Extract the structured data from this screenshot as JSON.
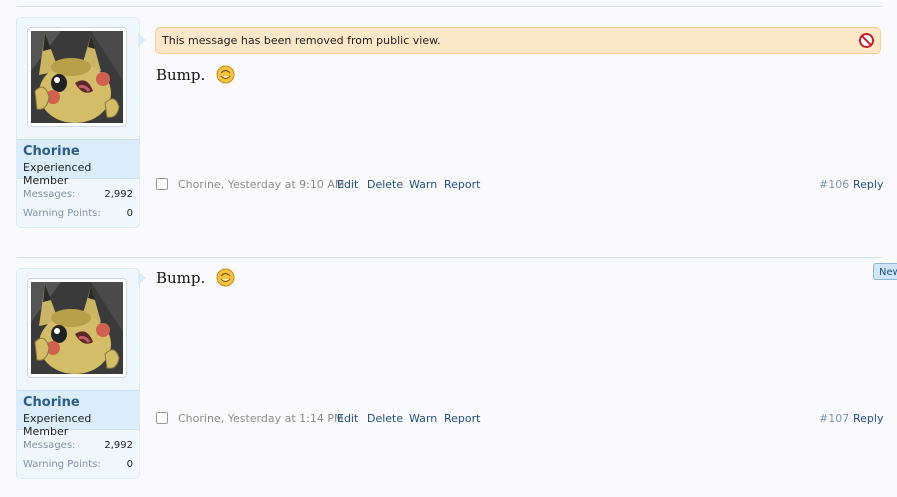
{
  "posts": [
    {
      "username": "Chorine",
      "user_title": "Experienced Member",
      "stats": [
        {
          "label": "Messages:",
          "value": "2,992"
        },
        {
          "label": "Warning Points:",
          "value": "0"
        }
      ],
      "notice": "This message has been removed from public view.",
      "message": "Bump.",
      "meta": "Chorine, Yesterday at 9:10 AM",
      "actions": [
        "Edit",
        "Delete",
        "Warn",
        "Report"
      ],
      "post_number": "#106",
      "reply_label": "Reply"
    },
    {
      "username": "Chorine",
      "user_title": "Experienced Member",
      "stats": [
        {
          "label": "Messages:",
          "value": "2,992"
        },
        {
          "label": "Warning Points:",
          "value": "0"
        }
      ],
      "message": "Bump.",
      "meta": "Chorine, Yesterday at 1:14 PM",
      "actions": [
        "Edit",
        "Delete",
        "Warn",
        "Report"
      ],
      "post_number": "#107",
      "reply_label": "Reply"
    }
  ],
  "new_badge": "New",
  "icons": {
    "notice": "no-entry-icon",
    "emoji": "smiley-face-icon",
    "avatar": "pikachu-avatar"
  },
  "colors": {
    "username": "#2b5d8a",
    "link": "#1f4f82",
    "notice_bg": "#fde7c9",
    "userblock_bg": "#f0f7fc"
  }
}
